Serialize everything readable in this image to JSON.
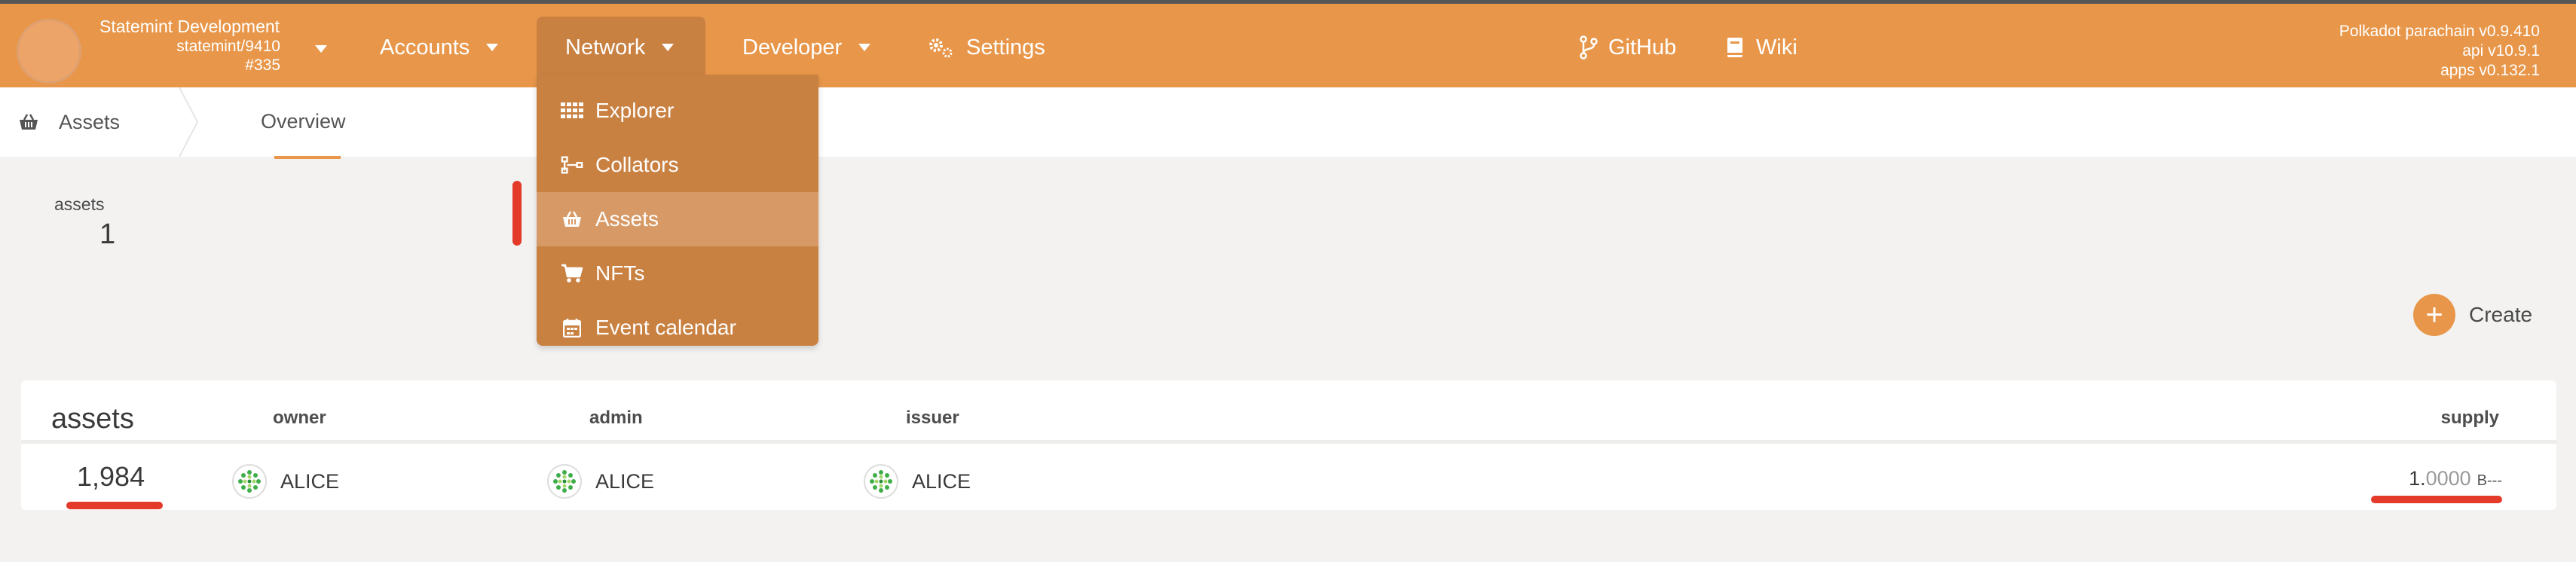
{
  "header": {
    "chain_name": "Statemint Development",
    "chain_sub": "statemint/9410",
    "block": "#335",
    "nav": {
      "accounts": "Accounts",
      "network": "Network",
      "developer": "Developer",
      "settings": "Settings",
      "github": "GitHub",
      "wiki": "Wiki"
    },
    "version_lines": [
      "Polkadot parachain v0.9.410",
      "api v10.9.1",
      "apps v0.132.1"
    ]
  },
  "subnav": {
    "section": "Assets",
    "tab": "Overview"
  },
  "network_menu": {
    "items": [
      {
        "label": "Explorer",
        "icon": "grid-icon"
      },
      {
        "label": "Collators",
        "icon": "network-icon"
      },
      {
        "label": "Assets",
        "icon": "basket-icon",
        "active": true
      },
      {
        "label": "NFTs",
        "icon": "cart-icon"
      },
      {
        "label": "Event calendar",
        "icon": "calendar-icon"
      }
    ]
  },
  "summary": {
    "label": "assets",
    "value": "1"
  },
  "create_label": "Create",
  "table": {
    "headers": {
      "assets": "assets",
      "owner": "owner",
      "admin": "admin",
      "issuer": "issuer",
      "supply": "supply"
    },
    "rows": [
      {
        "id": "1,984",
        "owner": "ALICE",
        "admin": "ALICE",
        "issuer": "ALICE",
        "supply_int": "1.",
        "supply_dec": "0000",
        "supply_unit": "B---"
      }
    ]
  },
  "colors": {
    "accent": "#e8974a",
    "menu_bg": "#c98142",
    "annotation": "#e33a2a"
  }
}
